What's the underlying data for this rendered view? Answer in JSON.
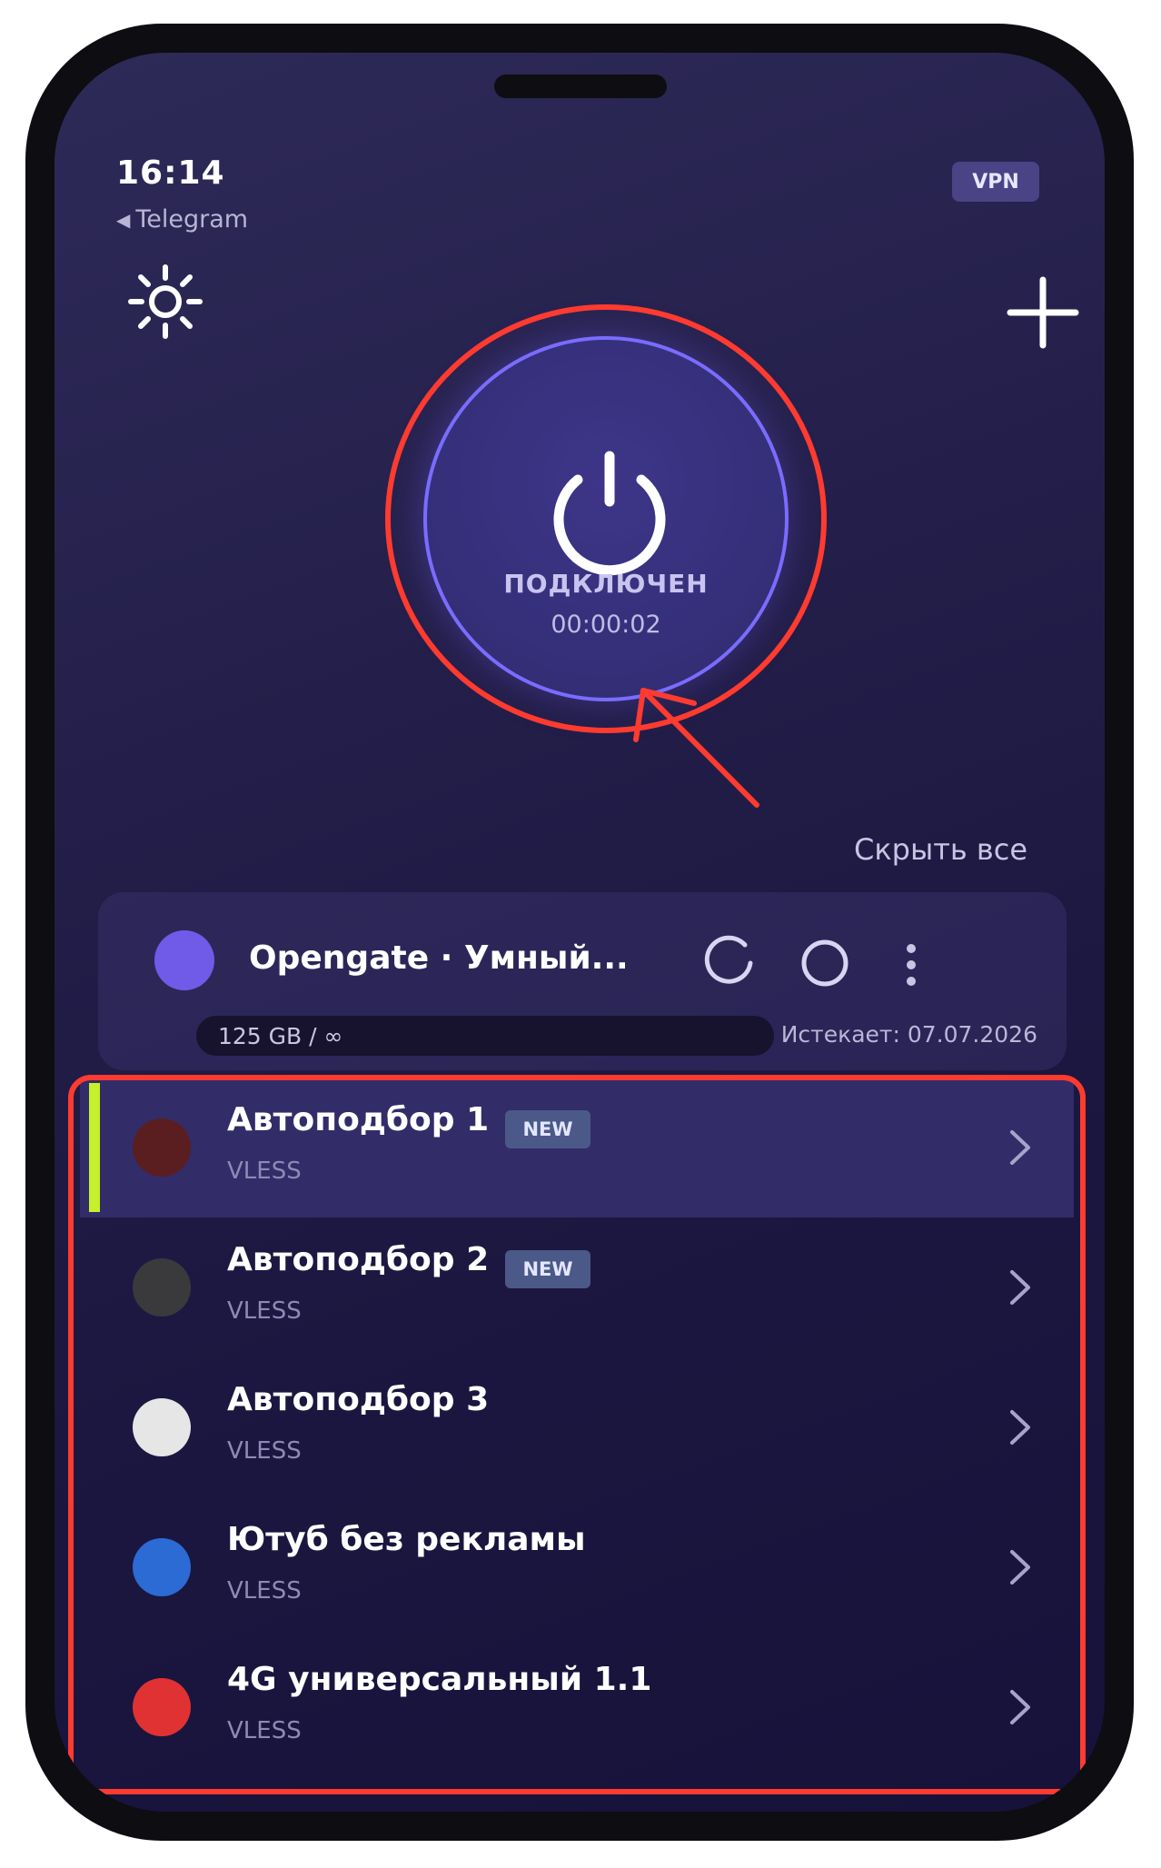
{
  "status_bar": {
    "time": "16:14",
    "back_app": "Telegram",
    "vpn_badge": "VPN"
  },
  "icons": {
    "settings": "sun-icon",
    "add": "plus-icon",
    "power": "power-icon",
    "refresh": "refresh-icon",
    "ping": "circle-icon",
    "more": "more-vertical-icon",
    "chevron": "chevron-right-icon",
    "back": "triangle-left-icon"
  },
  "connection": {
    "status": "ПОДКЛЮЧЕН",
    "timer": "00:00:02"
  },
  "hide_all_label": "Скрыть все",
  "subscription": {
    "name": "Opengate · Умный...",
    "usage": "125 GB / ∞",
    "expires": "Истекает: 07.07.2026"
  },
  "servers": [
    {
      "name": "Автоподбор 1",
      "protocol": "VLESS",
      "badge": "NEW",
      "dot_color": "#5a1e20",
      "active": true
    },
    {
      "name": "Автоподбор 2",
      "protocol": "VLESS",
      "badge": "NEW",
      "dot_color": "#3a3a3c",
      "active": false
    },
    {
      "name": "Автоподбор 3",
      "protocol": "VLESS",
      "badge": "",
      "dot_color": "#e6e6e6",
      "active": false
    },
    {
      "name": "Ютуб без рекламы",
      "protocol": "VLESS",
      "badge": "",
      "dot_color": "#2c6ad4",
      "active": false
    },
    {
      "name": "4G универсальный 1.1",
      "protocol": "VLESS",
      "badge": "",
      "dot_color": "#e03232",
      "active": false
    }
  ],
  "colors": {
    "accent": "#7a6cff",
    "active_indicator": "#c5f02a",
    "annotation": "#ff3b30",
    "background": "#1b1740"
  }
}
